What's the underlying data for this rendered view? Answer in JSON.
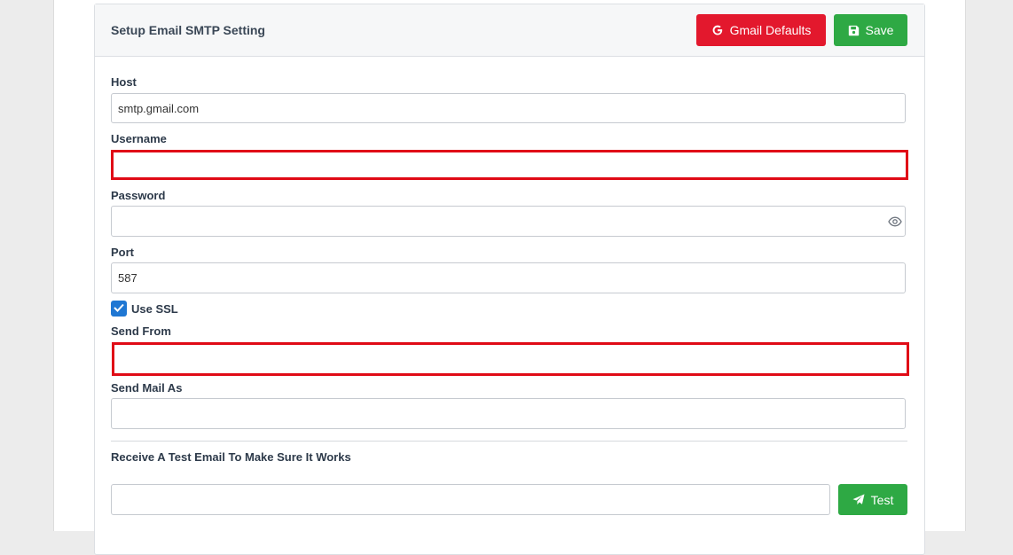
{
  "card": {
    "title": "Setup Email SMTP Setting",
    "gmail_defaults_label": "Gmail Defaults",
    "save_label": "Save"
  },
  "form": {
    "host": {
      "label": "Host",
      "value": "smtp.gmail.com"
    },
    "username": {
      "label": "Username",
      "value": ""
    },
    "password": {
      "label": "Password",
      "value": ""
    },
    "port": {
      "label": "Port",
      "value": "587"
    },
    "use_ssl": {
      "label": "Use SSL",
      "checked": true
    },
    "send_from": {
      "label": "Send From",
      "value": ""
    },
    "send_mail_as": {
      "label": "Send Mail As",
      "value": ""
    }
  },
  "test": {
    "heading": "Receive A Test Email To Make Sure It Works",
    "email_value": "",
    "button_label": "Test"
  },
  "icons": {
    "gmail_button": "google-g-icon",
    "save_button": "floppy-disk-icon",
    "password_toggle": "eye-icon",
    "checkbox": "checkmark-icon",
    "test_button": "paper-plane-icon"
  },
  "colors": {
    "danger": "#e3182d",
    "success": "#2ea944",
    "error_border": "#e00b16",
    "checkbox": "#1f77d3"
  }
}
